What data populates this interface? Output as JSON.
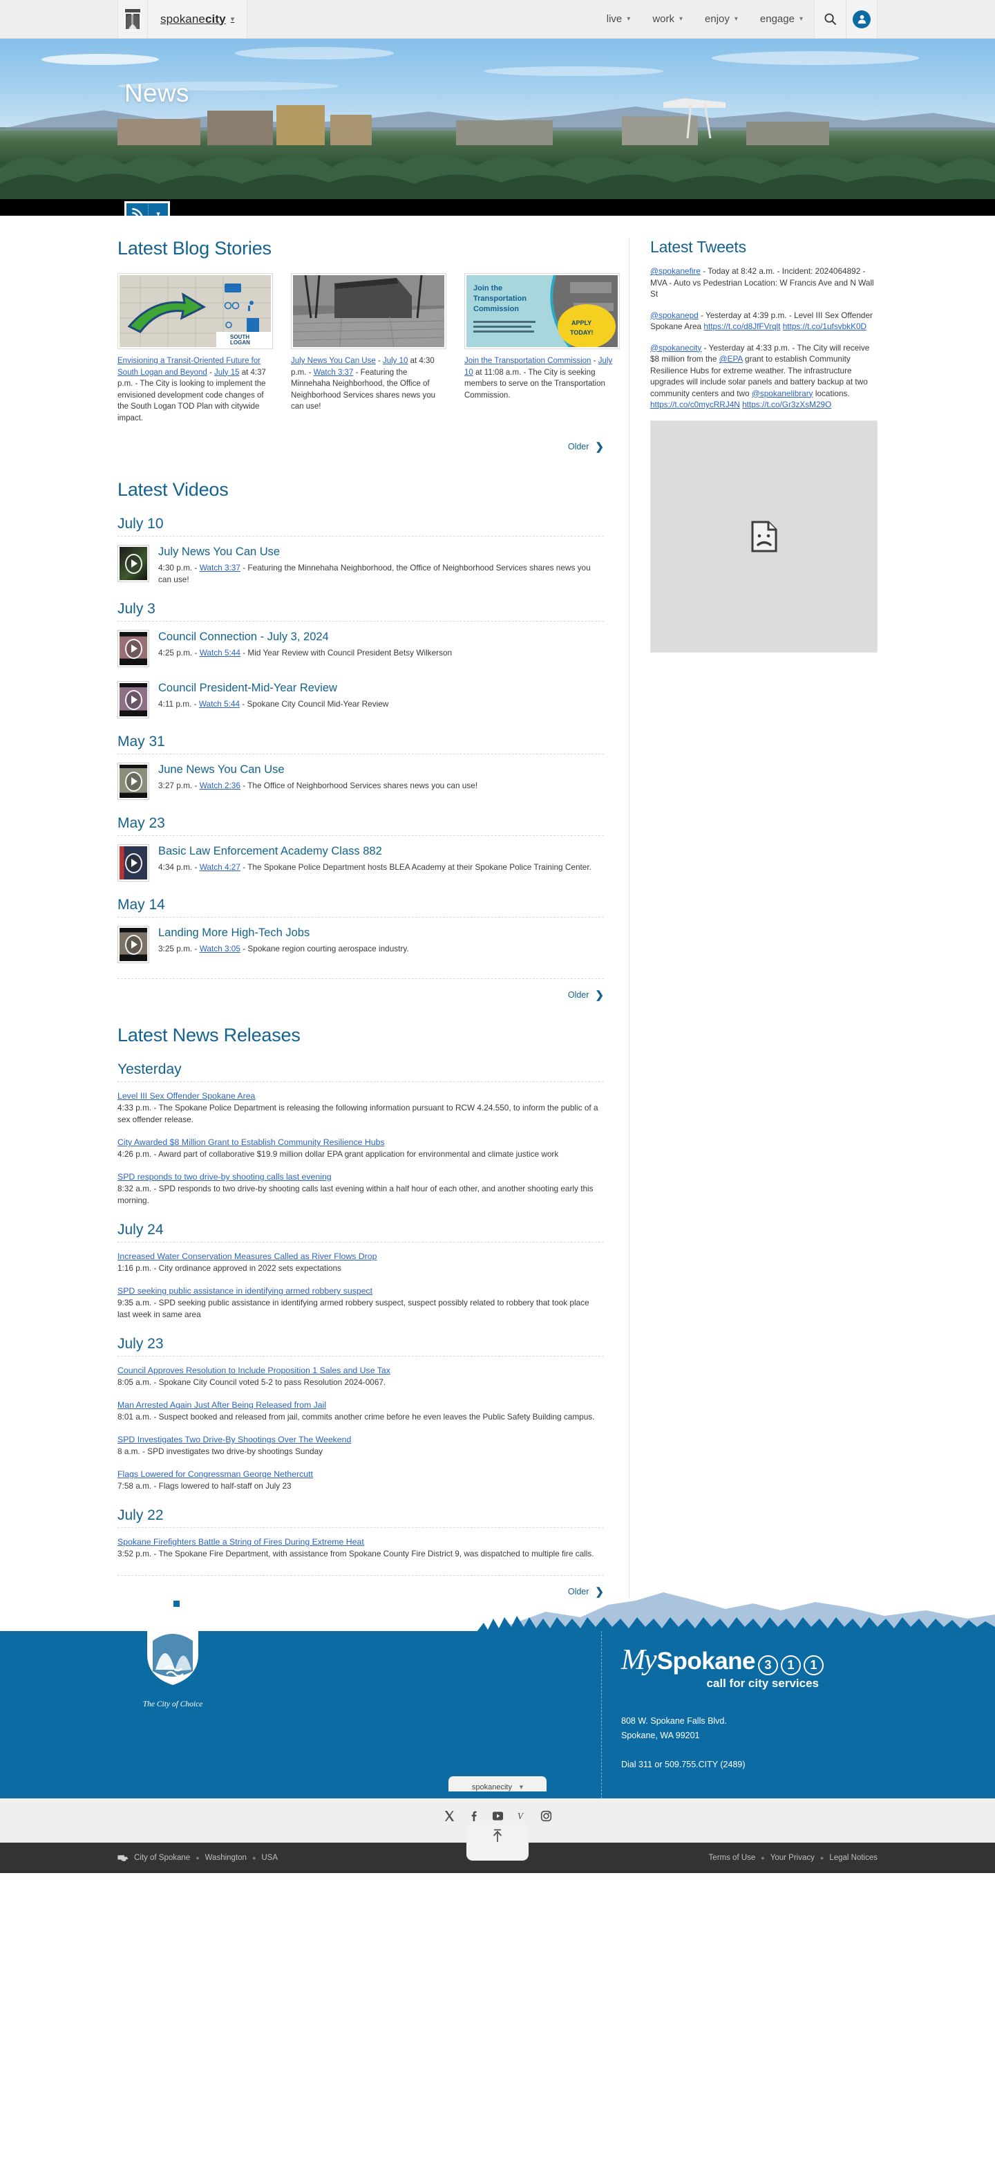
{
  "nav": {
    "brand_part1": "spokane",
    "brand_part2": "city",
    "items": [
      {
        "label": "live"
      },
      {
        "label": "work"
      },
      {
        "label": "enjoy"
      },
      {
        "label": "engage"
      }
    ],
    "search_icon": "search-icon",
    "account_icon": "user-avatar-icon"
  },
  "hero": {
    "title": "News",
    "rss_icon": "rss-feed-icon",
    "rss_dropdown_icon": "chevron-down-icon"
  },
  "blog": {
    "heading": "Latest Blog Stories",
    "older_label": "Older",
    "cards": [
      {
        "title": "Envisioning a Transit-Oriented Future for South Logan and Beyond",
        "date": "July 15",
        "time": "at 4:37 p.m.",
        "summary": "The City is looking to implement the envisioned development code changes of the South Logan TOD Plan with citywide impact.",
        "thumb_alt": "south-logan-tod-plan-map"
      },
      {
        "title": "July News You Can Use",
        "date": "July 10",
        "time": "at 4:30 p.m.",
        "watch_label": "Watch 3:37",
        "summary": "Featuring the Minnehaha Neighborhood, the Office of Neighborhood Services shares news you can use!",
        "thumb_alt": "minnehaha-rock-shelter-photo"
      },
      {
        "title": "Join the Transportation Commission",
        "date": "July 10",
        "time": "at 11:08 a.m.",
        "summary": "The City is seeking members to serve on the Transportation Commission.",
        "thumb_alt": "transportation-commission-apply-today-graphic"
      }
    ]
  },
  "videos": {
    "heading": "Latest Videos",
    "older_label": "Older",
    "groups": [
      {
        "date": "July 10",
        "items": [
          {
            "title": "July News You Can Use",
            "time": "4:30 p.m.",
            "watch_label": "Watch 3:37",
            "desc": "Featuring the Minnehaha Neighborhood, the Office of Neighborhood Services shares news you can use!"
          }
        ]
      },
      {
        "date": "July 3",
        "items": [
          {
            "title": "Council Connection - July 3, 2024",
            "time": "4:25 p.m.",
            "watch_label": "Watch 5:44",
            "desc": "Mid Year Review with Council President Betsy Wilkerson"
          },
          {
            "title": "Council President-Mid-Year Review",
            "time": "4:11 p.m.",
            "watch_label": "Watch 5:44",
            "desc": "Spokane City Council Mid-Year Review"
          }
        ]
      },
      {
        "date": "May 31",
        "items": [
          {
            "title": "June News You Can Use",
            "time": "3:27 p.m.",
            "watch_label": "Watch 2:36",
            "desc": "The Office of Neighborhood Services shares news you can use!"
          }
        ]
      },
      {
        "date": "May 23",
        "items": [
          {
            "title": "Basic Law Enforcement Academy Class 882",
            "time": "4:34 p.m.",
            "watch_label": "Watch 4:27",
            "desc": "The Spokane Police Department hosts BLEA Academy at their Spokane Police Training Center."
          }
        ]
      },
      {
        "date": "May 14",
        "items": [
          {
            "title": "Landing More High-Tech Jobs",
            "time": "3:25 p.m.",
            "watch_label": "Watch 3:05",
            "desc": "Spokane region courting aerospace industry."
          }
        ]
      }
    ]
  },
  "news": {
    "heading": "Latest News Releases",
    "older_label": "Older",
    "groups": [
      {
        "date": "Yesterday",
        "items": [
          {
            "title": "Level III Sex Offender Spokane Area",
            "body": "4:33 p.m. - The Spokane Police Department is releasing the following information pursuant to RCW 4.24.550, to inform the public of a sex offender release."
          },
          {
            "title": "City Awarded $8 Million Grant to Establish Community Resilience Hubs",
            "body": "4:26 p.m. - Award part of collaborative $19.9 million dollar EPA grant application for environmental and climate justice work"
          },
          {
            "title": "SPD responds to two drive-by shooting calls last evening",
            "body": "8:32 a.m. - SPD responds to two drive-by shooting calls last evening within a half hour of each other, and another shooting early this morning."
          }
        ]
      },
      {
        "date": "July 24",
        "items": [
          {
            "title": "Increased Water Conservation Measures Called as River Flows Drop",
            "body": "1:16 p.m. - City ordinance approved in 2022 sets expectations"
          },
          {
            "title": "SPD seeking public assistance in identifying armed robbery suspect",
            "body": "9:35 a.m. - SPD seeking public assistance in identifying armed robbery suspect, suspect possibly related to robbery that took place last week in same area"
          }
        ]
      },
      {
        "date": "July 23",
        "items": [
          {
            "title": "Council Approves Resolution to Include Proposition 1 Sales and Use Tax",
            "body": "8:05 a.m. - Spokane City Council voted 5-2 to pass Resolution 2024-0067."
          },
          {
            "title": "Man Arrested Again Just After Being Released from Jail",
            "body": "8:01 a.m. - Suspect booked and released from jail, commits another crime before he even leaves the Public Safety Building campus."
          },
          {
            "title": "SPD Investigates Two Drive-By Shootings Over The Weekend",
            "body": "8 a.m. - SPD investigates two drive-by shootings Sunday"
          },
          {
            "title": "Flags Lowered for Congressman George Nethercutt",
            "body": "7:58 a.m. - Flags lowered to half-staff on July 23"
          }
        ]
      },
      {
        "date": "July 22",
        "items": [
          {
            "title": "Spokane Firefighters Battle a String of Fires During Extreme Heat",
            "body": "3:52 p.m. - The Spokane Fire Department, with assistance from Spokane County Fire District 9, was dispatched to multiple fire calls."
          }
        ]
      }
    ]
  },
  "tweets": {
    "heading": "Latest Tweets",
    "items": [
      {
        "handle": "@spokanefire",
        "text": " - Today at 8:42 a.m. - Incident: 2024064892 - MVA - Auto vs Pedestrian Location: W Francis Ave and N Wall St"
      },
      {
        "handle": "@spokanepd",
        "text": " - Yesterday at 4:39 p.m. - Level III Sex Offender Spokane Area ",
        "link1": "https://t.co/d8JfFVrqlt",
        "link2": "https://t.co/1ufsvbkK0D"
      },
      {
        "handle": "@spokanecity",
        "text_a": " - Yesterday at 4:33 p.m. - The City will receive $8 million from the ",
        "mention_epa": "@EPA",
        "text_b": " grant to establish Community Resilience Hubs for extreme weather. The infrastructure upgrades will include solar panels and battery backup at two community centers and two ",
        "mention_library": "@spokanelibrary",
        "text_c": " locations.",
        "link1": "https://t.co/c0mycRRJ4N",
        "link2": "https://t.co/Gr3zXsM29O"
      }
    ],
    "broken_image_alt": "broken-image-placeholder"
  },
  "footer": {
    "seal_alt": "city-of-spokane-seal",
    "tagline": "The City of Choice",
    "brand_my": "My",
    "brand_spokane": "Spokane",
    "brand_digits": [
      "3",
      "1",
      "1"
    ],
    "brand_sub": "call for city services",
    "address_line1": "808 W. Spokane Falls Blvd.",
    "address_line2": "Spokane, WA 99201",
    "dial": "Dial 311 or 509.755.CITY (2489)",
    "social_tab_label": "spokanecity",
    "social": [
      {
        "name": "x-twitter-icon",
        "glyph": "X"
      },
      {
        "name": "facebook-icon",
        "glyph": "f"
      },
      {
        "name": "youtube-icon",
        "glyph": "▶"
      },
      {
        "name": "vimeo-icon",
        "glyph": "V"
      },
      {
        "name": "instagram-icon",
        "glyph": "▢"
      }
    ],
    "back_to_top_icon": "back-to-top-arrow-icon",
    "bottom_left": [
      "City of Spokane",
      "Washington",
      "USA"
    ],
    "bottom_right": [
      "Terms of Use",
      "Your Privacy",
      "Legal Notices"
    ]
  },
  "colors": {
    "brand_blue": "#0d6ba4",
    "heading_blue": "#14628f",
    "link_blue": "#2b62c4",
    "footer_dark": "#333333",
    "nav_bg": "#efefef"
  }
}
